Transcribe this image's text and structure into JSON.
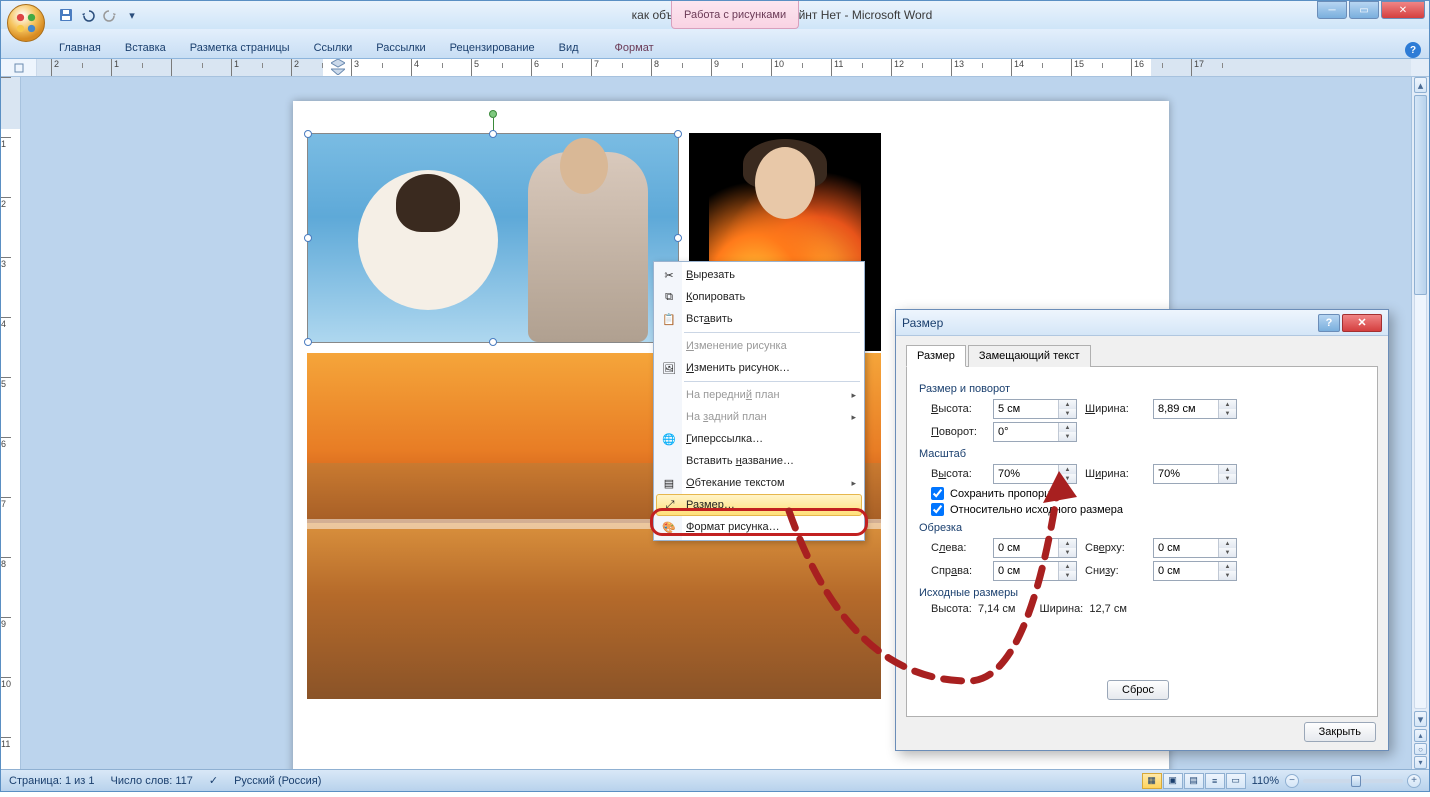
{
  "titlebar": {
    "title": "как объединять картинки в Пэйнт Нет - Microsoft Word",
    "context_tab_group": "Работа с рисунками"
  },
  "ribbon": {
    "tabs": [
      "Главная",
      "Вставка",
      "Разметка страницы",
      "Ссылки",
      "Рассылки",
      "Рецензирование",
      "Вид"
    ],
    "context_tab": "Формат"
  },
  "context_menu": {
    "items": [
      {
        "label": "Вырезать",
        "underline": "В",
        "icon": "cut-icon"
      },
      {
        "label": "Копировать",
        "underline": "К",
        "icon": "copy-icon"
      },
      {
        "label": "Вставить",
        "underline": "В",
        "icon": "paste-icon"
      },
      {
        "label": "Изменение рисунка",
        "underline": "И",
        "disabled": true
      },
      {
        "label": "Изменить рисунок…",
        "underline": "И",
        "icon": "edit-picture-icon"
      },
      {
        "label": "На передний план",
        "underline": "й",
        "disabled": true,
        "submenu": true
      },
      {
        "label": "На задний план",
        "underline": "з",
        "disabled": true,
        "submenu": true
      },
      {
        "label": "Гиперссылка…",
        "underline": "Г",
        "icon": "hyperlink-icon"
      },
      {
        "label": "Вставить название…",
        "underline": "н"
      },
      {
        "label": "Обтекание текстом",
        "underline": "О",
        "icon": "wrap-icon",
        "submenu": true
      },
      {
        "label": "Размер…",
        "underline": "Р",
        "icon": "size-icon",
        "highlighted": true
      },
      {
        "label": "Формат рисунка…",
        "underline": "Ф",
        "icon": "format-picture-icon"
      }
    ]
  },
  "dialog": {
    "title": "Размер",
    "tabs": [
      "Размер",
      "Замещающий текст"
    ],
    "groups": {
      "size_rotation": {
        "title": "Размер и поворот",
        "height_label": "Высота:",
        "height_value": "5 см",
        "width_label": "Ширина:",
        "width_value": "8,89 см",
        "rotation_label": "Поворот:",
        "rotation_value": "0°"
      },
      "scale": {
        "title": "Масштаб",
        "height_label": "Высота:",
        "height_value": "70%",
        "width_label": "Ширина:",
        "width_value": "70%",
        "lock_aspect": "Сохранить пропорции",
        "relative_original": "Относительно исходного размера"
      },
      "crop": {
        "title": "Обрезка",
        "left_label": "Слева:",
        "left_value": "0 см",
        "top_label": "Сверху:",
        "top_value": "0 см",
        "right_label": "Справа:",
        "right_value": "0 см",
        "bottom_label": "Снизу:",
        "bottom_value": "0 см"
      },
      "original": {
        "title": "Исходные размеры",
        "height_label": "Высота:",
        "height_value": "7,14 см",
        "width_label": "Ширина:",
        "width_value": "12,7 см"
      }
    },
    "reset_btn": "Сброс",
    "close_btn": "Закрыть"
  },
  "statusbar": {
    "page": "Страница: 1 из 1",
    "words": "Число слов: 117",
    "lang": "Русский (Россия)",
    "zoom": "110%"
  },
  "ruler_h_numbers": [
    "2",
    "1",
    "",
    "1",
    "2",
    "3",
    "4",
    "5",
    "6",
    "7",
    "8",
    "9",
    "10",
    "11",
    "12",
    "13",
    "14",
    "15",
    "16",
    "17"
  ],
  "ruler_v_numbers": [
    "",
    "1",
    "2",
    "3",
    "4",
    "5",
    "6",
    "7",
    "8",
    "9",
    "10",
    "11"
  ]
}
